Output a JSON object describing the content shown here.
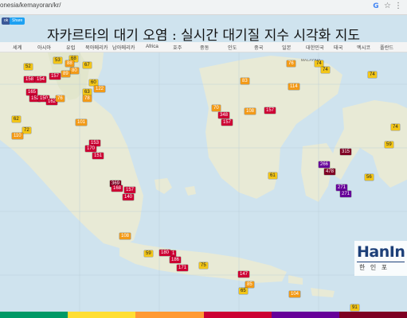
{
  "browser": {
    "url": "onesia/kemayoran/kr/",
    "share_label": "Share",
    "fb_label": "ok"
  },
  "title": "자카르타의 대기 오염 : 실시간 대기질 지수 시각화 지도",
  "nav": [
    "세계",
    "아시아",
    "유럽",
    "북아메리카",
    "남아메리카",
    "Africa",
    "호주",
    "중동",
    "인도",
    "중국",
    "일본",
    "대한민국",
    "태국",
    "멕시코",
    "폴란드"
  ],
  "labels": {
    "malaysia": "MALAYSIA"
  },
  "legend_colors": [
    "#009966",
    "#ffde33",
    "#ff9933",
    "#cc0033",
    "#660099",
    "#7e0023"
  ],
  "markers": [
    {
      "v": "52",
      "c": "#f2c518"
    },
    {
      "v": "68",
      "c": "#f2c518"
    },
    {
      "v": "53",
      "c": "#f2c518"
    },
    {
      "v": "88",
      "c": "#f29a18"
    },
    {
      "v": "80",
      "c": "#f29a18"
    },
    {
      "v": "67",
      "c": "#f2c518"
    },
    {
      "v": "89",
      "c": "#f29a18"
    },
    {
      "v": "158",
      "c": "#cc0033"
    },
    {
      "v": "154",
      "c": "#cc0033"
    },
    {
      "v": "157",
      "c": "#cc0033"
    },
    {
      "v": "63",
      "c": "#f2c518"
    },
    {
      "v": "60",
      "c": "#f2c518"
    },
    {
      "v": "122",
      "c": "#f29a18"
    },
    {
      "v": "78",
      "c": "#f29a18"
    },
    {
      "v": "165",
      "c": "#cc0033"
    },
    {
      "v": "152",
      "c": "#cc0033"
    },
    {
      "v": "150",
      "c": "#cc0033"
    },
    {
      "v": "162",
      "c": "#cc0033"
    },
    {
      "v": "76",
      "c": "#f29a18"
    },
    {
      "v": "62",
      "c": "#f2c518"
    },
    {
      "v": "72",
      "c": "#f2c518"
    },
    {
      "v": "110",
      "c": "#f29a18"
    },
    {
      "v": "101",
      "c": "#f29a18"
    },
    {
      "v": "153",
      "c": "#cc0033"
    },
    {
      "v": "170",
      "c": "#cc0033"
    },
    {
      "v": "151",
      "c": "#cc0033"
    },
    {
      "v": "369",
      "c": "#7e0023"
    },
    {
      "v": "168",
      "c": "#cc0033"
    },
    {
      "v": "157",
      "c": "#cc0033"
    },
    {
      "v": "140",
      "c": "#cc0033"
    },
    {
      "v": "108",
      "c": "#f29a18"
    },
    {
      "v": "59",
      "c": "#f2c518"
    },
    {
      "v": "180",
      "c": "#cc0033"
    },
    {
      "v": "1",
      "c": "#cc0033"
    },
    {
      "v": "186",
      "c": "#cc0033"
    },
    {
      "v": "171",
      "c": "#cc0033"
    },
    {
      "v": "75",
      "c": "#f2c518"
    },
    {
      "v": "147",
      "c": "#cc0033"
    },
    {
      "v": "85",
      "c": "#f29a18"
    },
    {
      "v": "65",
      "c": "#f2c518"
    },
    {
      "v": "104",
      "c": "#f29a18"
    },
    {
      "v": "91",
      "c": "#f2c518"
    },
    {
      "v": "83",
      "c": "#f29a18"
    },
    {
      "v": "76",
      "c": "#f29a18"
    },
    {
      "v": "74",
      "c": "#f2c518"
    },
    {
      "v": "114",
      "c": "#f29a18"
    },
    {
      "v": "74",
      "c": "#f2c518"
    },
    {
      "v": "70",
      "c": "#f29a18"
    },
    {
      "v": "348",
      "c": "#cc0033"
    },
    {
      "v": "108",
      "c": "#f29a18"
    },
    {
      "v": "157",
      "c": "#cc0033"
    },
    {
      "v": "157",
      "c": "#cc0033"
    },
    {
      "v": "61",
      "c": "#f2c518"
    },
    {
      "v": "315",
      "c": "#7e0023"
    },
    {
      "v": "266",
      "c": "#660099"
    },
    {
      "v": "478",
      "c": "#7e0023"
    },
    {
      "v": "271",
      "c": "#660099"
    },
    {
      "v": "271",
      "c": "#660099"
    },
    {
      "v": "56",
      "c": "#f2c518"
    },
    {
      "v": "74",
      "c": "#f2c518"
    },
    {
      "v": "59",
      "c": "#f2c518"
    },
    {
      "v": "74",
      "c": "#f2c518"
    }
  ]
}
